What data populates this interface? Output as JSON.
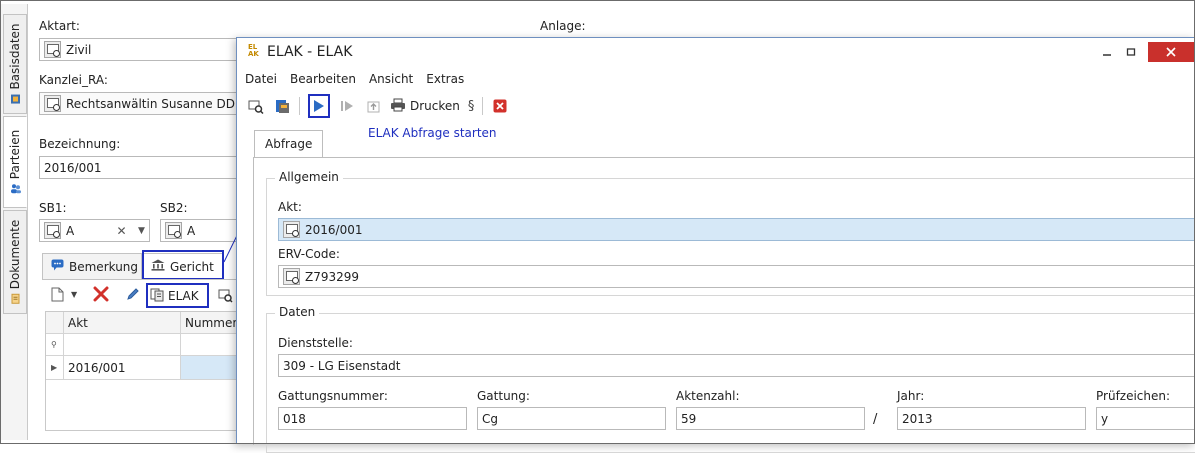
{
  "left_tabs": [
    {
      "label": "Basisdaten",
      "icon": "house-icon"
    },
    {
      "label": "Parteien",
      "icon": "people-icon"
    },
    {
      "label": "Dokumente",
      "icon": "document-icon"
    }
  ],
  "form": {
    "aktart_label": "Aktart:",
    "aktart_value": "Zivil",
    "anlage_label": "Anlage:",
    "kanzlei_label": "Kanzlei_RA:",
    "kanzlei_value": "Rechtsanwältin Susanne DDr.",
    "bezeichnung_label": "Bezeichnung:",
    "bezeichnung_value": "2016/001",
    "sb1_label": "SB1:",
    "sb1_value": "A",
    "sb2_label": "SB2:",
    "sb2_value": "A"
  },
  "subtabs": [
    {
      "label": "Bemerkung",
      "icon": "comment-icon"
    },
    {
      "label": "Gericht",
      "icon": "court-icon"
    }
  ],
  "subtoolbar": {
    "elak_label": "ELAK"
  },
  "grid": {
    "columns": [
      "Akt",
      "Nummer"
    ],
    "rows": [
      [
        "2016/001",
        ""
      ]
    ]
  },
  "dialog": {
    "app_icon_text": "EL AK",
    "title": "ELAK - ELAK",
    "menu": [
      "Datei",
      "Bearbeiten",
      "Ansicht",
      "Extras"
    ],
    "toolbar": {
      "print_label": "Drucken",
      "paragraph_label": "§"
    },
    "annotation": "ELAK Abfrage starten",
    "tab": "Abfrage",
    "allgemein": {
      "title": "Allgemein",
      "akt_label": "Akt:",
      "akt_value": "2016/001",
      "erv_label": "ERV-Code:",
      "erv_value": "Z793299"
    },
    "daten": {
      "title": "Daten",
      "dienststelle_label": "Dienststelle:",
      "dienststelle_value": "309 - LG Eisenstadt",
      "gattungsnummer_label": "Gattungsnummer:",
      "gattungsnummer_value": "018",
      "gattung_label": "Gattung:",
      "gattung_value": "Cg",
      "aktenzahl_label": "Aktenzahl:",
      "aktenzahl_value": "59",
      "slash": "/",
      "jahr_label": "Jahr:",
      "jahr_value": "2013",
      "pruefzeichen_label": "Prüfzeichen:",
      "pruefzeichen_value": "y"
    }
  },
  "colors": {
    "accent": "#1f2fbf",
    "play": "#2b6cc4",
    "close": "#c9302c",
    "selection": "#d6e8f7"
  }
}
